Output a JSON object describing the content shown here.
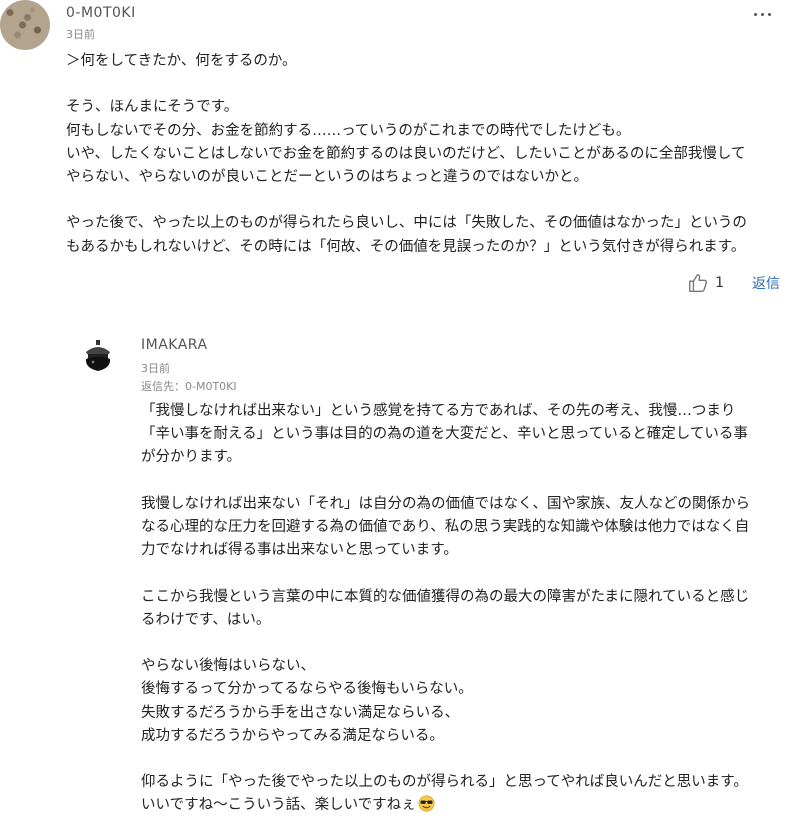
{
  "comments": [
    {
      "username": "0-M0T0KI",
      "time": "3日前",
      "body": "＞何をしてきたか、何をするのか。\n\nそう、ほんまにそうです。\n何もしないでその分、お金を節約する……っていうのがこれまでの時代でしたけども。\nいや、したくないことはしないでお金を節約するのは良いのだけど、したいことがあるのに全部我慢して\nやらない、やらないのが良いことだーというのはちょっと違うのではないかと。\n\nやった後で、やった以上のものが得られたら良いし、中には「失敗した、その価値はなかった」というの\nもあるかもしれないけど、その時には「何故、その価値を見誤ったのか？」という気付きが得られます。",
      "like_count": "1",
      "reply_label": "返信",
      "avatar_icon": "pebbles-avatar-icon",
      "more_icon": "more-options-icon"
    },
    {
      "username": "IMAKARA",
      "time": "3日前",
      "reply_to": "返信先：0-M0T0KI",
      "body": "「我慢しなければ出来ない」という感覚を持てる方であれば、その先の考え、我慢…つまり\n「辛い事を耐える」という事は目的の為の道を大変だと、辛いと思っていると確定している事\nが分かります。\n\n我慢しなければ出来ない「それ」は自分の為の価値ではなく、国や家族、友人などの関係から\nなる心理的な圧力を回避する為の価値であり、私の思う実践的な知識や体験は他力ではなく自\n力でなければ得る事は出来ないと思っています。\n\nここから我慢という言葉の中に本質的な価値獲得の為の最大の障害がたまに隠れていると感じ\nるわけです、はい。\n\nやらない後悔はいらない、\n後悔するって分かってるならやる後悔もいらない。\n失敗するだろうから手を出さない満足ならいる、\n成功するだろうからやってみる満足ならいる。\n\n仰るように「やった後でやった以上のものが得られる」と思ってやれば良いんだと思います。\nいいですね〜こういう話、楽しいですねぇ",
      "avatar_icon": "character-avatar-icon",
      "emoji_icon": "sunglasses-emoji-icon"
    }
  ],
  "colors": {
    "link": "#2d6db5",
    "meta": "#888888",
    "text": "#222222"
  }
}
